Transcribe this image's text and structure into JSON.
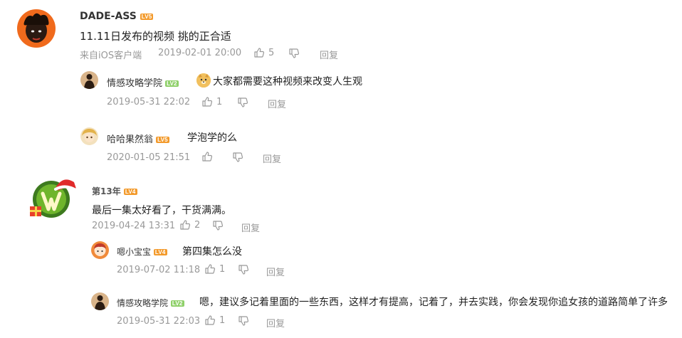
{
  "comments": [
    {
      "user": "DADE-ASS",
      "level": "LV5",
      "text": "11.11日发布的视频 挑的正合适",
      "source": "来自iOS客户端",
      "time": "2019-02-01 20:00",
      "likes": "5",
      "reply_label": "回复",
      "replies": [
        {
          "user": "情感攻略学院",
          "level": "LV2",
          "text": "大家都需要这种视频来改变人生观",
          "time": "2019-05-31 22:02",
          "likes": "1",
          "reply_label": "回复",
          "emoji": "doge-emoji"
        },
        {
          "user": "哈哈果然翁",
          "level": "LV5",
          "text": "学泡学的么",
          "time": "2020-01-05 21:51",
          "likes": "",
          "reply_label": "回复"
        }
      ]
    },
    {
      "floor": "第13年",
      "level": "LV4",
      "text": "最后一集太好看了，干货满满。",
      "time": "2019-04-24 13:31",
      "likes": "2",
      "reply_label": "回复",
      "replies": [
        {
          "user": "嗯小宝宝",
          "level": "LV4",
          "text": "第四集怎么没",
          "time": "2019-07-02 11:18",
          "likes": "1",
          "reply_label": "回复"
        },
        {
          "user": "情感攻略学院",
          "level": "LV2",
          "text": "嗯，建议多记着里面的一些东西，这样才有提高，记着了，并去实践，你会发现你追女孩的道路简单了许多",
          "time": "2019-05-31 22:03",
          "likes": "1",
          "reply_label": "回复"
        }
      ]
    }
  ],
  "colors": {
    "meta": "#999999",
    "level_orange": "#f39a2b",
    "level_green": "#8fd06a"
  },
  "icons": {
    "like": "thumbs-up-icon",
    "dislike": "thumbs-down-icon"
  }
}
